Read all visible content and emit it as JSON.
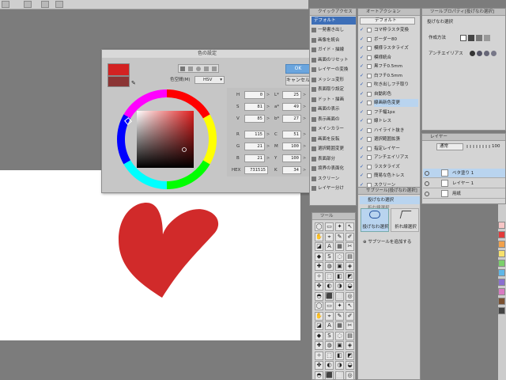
{
  "color_dialog": {
    "title": "色の設定",
    "ok_label": "OK",
    "cancel_label": "キャンセル",
    "color_space_label": "色空間(M)",
    "color_space_value": "HSV",
    "current_color": "#d32222",
    "previous_color": "#8b3535",
    "fields_left": [
      {
        "label": "H",
        "value": "0"
      },
      {
        "label": "S",
        "value": "81"
      },
      {
        "label": "V",
        "value": "85"
      },
      {
        "label": "R",
        "value": "115"
      },
      {
        "label": "G",
        "value": "21"
      },
      {
        "label": "B",
        "value": "21"
      },
      {
        "label": "HEX",
        "value": "731515"
      }
    ],
    "fields_right": [
      {
        "label": "L*",
        "value": "25"
      },
      {
        "label": "a*",
        "value": "49"
      },
      {
        "label": "b*",
        "value": "27"
      },
      {
        "label": "C",
        "value": "51"
      },
      {
        "label": "M",
        "value": "100"
      },
      {
        "label": "Y",
        "value": "100"
      },
      {
        "label": "K",
        "value": "34"
      }
    ]
  },
  "quick_access": {
    "title": "クイックアクセス",
    "tab": "デフォルト",
    "items": [
      "一発書き出し",
      "画像を統合",
      "ガイド・描線",
      "画面のリセット",
      "レイヤーの変換",
      "メッシュ変形",
      "表面取り設定",
      "ドット・描画",
      "画面の表示",
      "表示画面の",
      "メインカラー",
      "画面を反転",
      "選択範囲変更",
      "表面部分",
      "境界の表面化",
      "スクリーン",
      "レイヤー分け"
    ]
  },
  "auto_action": {
    "title": "オートアクション",
    "tab": "デフォルト",
    "items": [
      "コマ枠ラスタ変換",
      "ボーダー80",
      "模様ラスタライズ",
      "模様統合",
      "黒フチ0.5mm",
      "白フチ0.5mm",
      "吹き出しフチ取り",
      "自動彩色",
      "線画新色変更",
      "フチ幅1px",
      "線トレス",
      "ハイライト抜き",
      "選択範囲拡張",
      "指定レイヤー",
      "アンチエイリアス",
      "ラスタライズ",
      "簡易な色トレス",
      "スクリーン"
    ]
  },
  "tool_property": {
    "title": "ツールプロパティ[投げなわ選択]",
    "subtitle": "投げなわ選択",
    "creation_label": "作成方法",
    "antialias_label": "アンチエイリアス"
  },
  "layer_panel": {
    "title": "レイヤー",
    "blend_mode": "通常",
    "opacity": "100",
    "layers": [
      {
        "name": "ベタ塗り 1",
        "selected": true
      },
      {
        "name": "レイヤー 1",
        "selected": false
      },
      {
        "name": "用紙",
        "selected": false
      }
    ]
  },
  "sub_tool": {
    "title": "サブツール[投げなわ選択]",
    "item_selected": "投げなわ選択",
    "item_other": "折れ線選択",
    "primary": "投げなわ選択",
    "secondary": "折れ線選択",
    "add_label": "サブツールを追加する"
  },
  "tool_panel": {
    "title": "ツール"
  },
  "colors": {
    "heart": "#d12a2a",
    "accent": "#6aa5de",
    "selection": "#b9d4ef"
  }
}
